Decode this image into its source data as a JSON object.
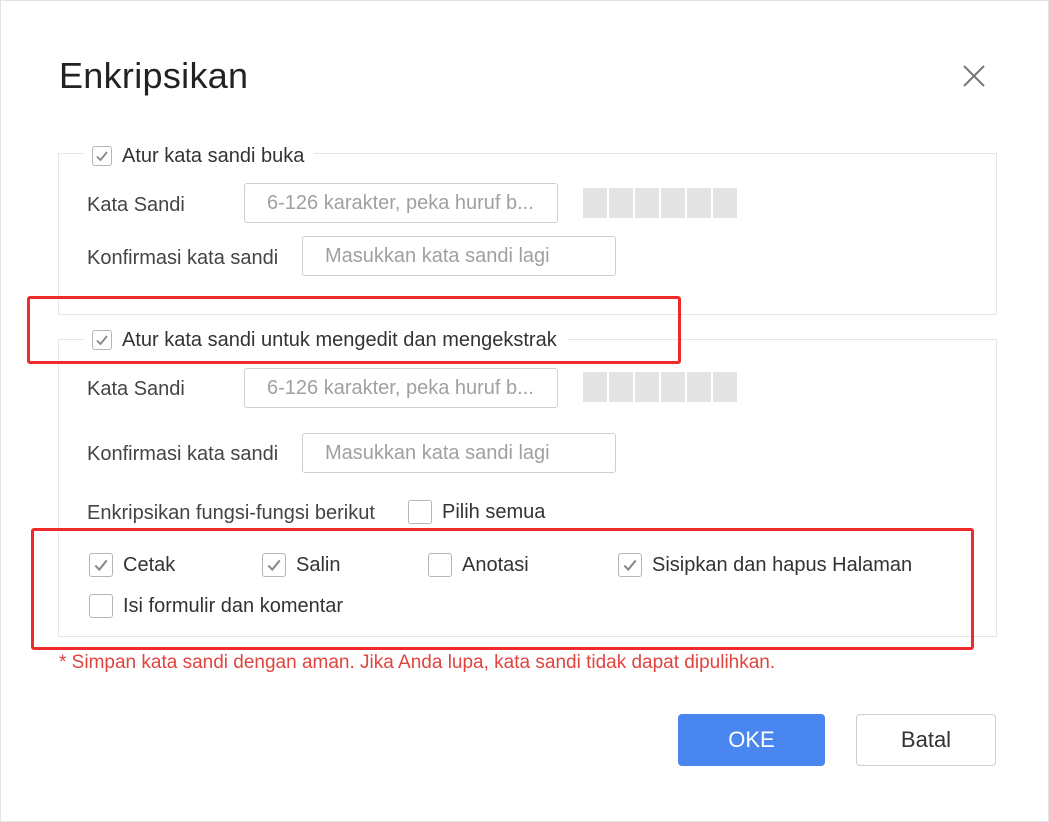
{
  "dialog": {
    "title": "Enkripsikan",
    "close_icon": "close-icon"
  },
  "open_password": {
    "checkbox_label": "Atur kata sandi buka",
    "checked": true,
    "password_label": "Kata Sandi",
    "password_placeholder": "6-126 karakter, peka huruf b...",
    "confirm_label": "Konfirmasi kata sandi",
    "confirm_placeholder": "Masukkan kata sandi lagi"
  },
  "edit_password": {
    "checkbox_label": "Atur kata sandi untuk mengedit dan mengekstrak",
    "checked": true,
    "password_label": "Kata Sandi",
    "password_placeholder": "6-126 karakter, peka huruf b...",
    "confirm_label": "Konfirmasi kata sandi",
    "confirm_placeholder": "Masukkan kata sandi lagi",
    "functions_label": "Enkripsikan fungsi-fungsi berikut",
    "select_all_label": "Pilih semua",
    "select_all_checked": false,
    "options": [
      {
        "label": "Cetak",
        "checked": true
      },
      {
        "label": "Salin",
        "checked": true
      },
      {
        "label": "Anotasi",
        "checked": false
      },
      {
        "label": "Sisipkan dan hapus Halaman",
        "checked": true
      },
      {
        "label": "Isi formulir dan komentar",
        "checked": false
      }
    ]
  },
  "warning": "*  Simpan kata sandi dengan aman. Jika Anda lupa, kata sandi tidak dapat dipulihkan.",
  "buttons": {
    "ok_label": "OKE",
    "cancel_label": "Batal"
  },
  "colors": {
    "accent": "#4a86f0",
    "warning": "#e0443f",
    "highlight_box": "#ee2a2a"
  }
}
